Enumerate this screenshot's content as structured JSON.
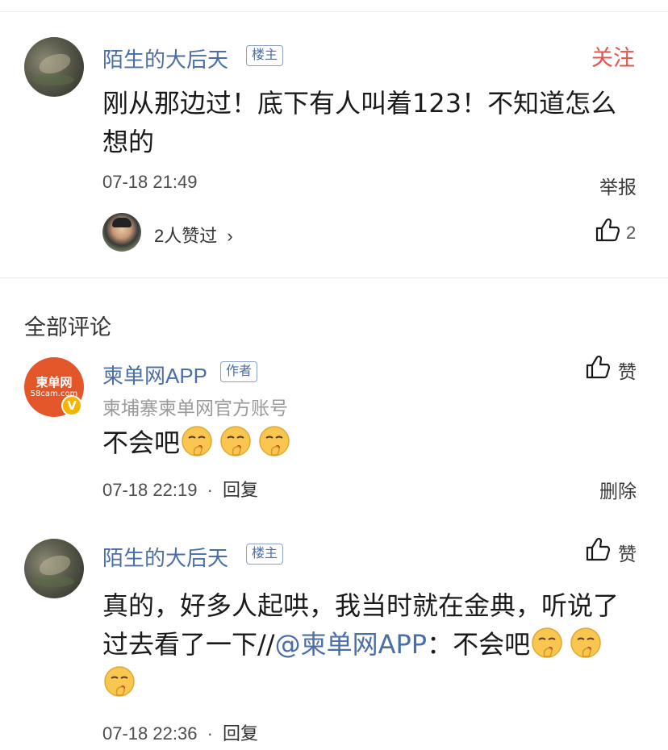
{
  "post": {
    "author": "陌生的大后天",
    "badge": "楼主",
    "follow_label": "关注",
    "content": "刚从那边过！底下有人叫着123！不知道怎么想的",
    "time": "07-18 21:49",
    "report_label": "举报",
    "likers_text": "2人赞过",
    "likers_chevron": "›",
    "like_count": "2"
  },
  "comments_section": {
    "title": "全部评论"
  },
  "comments": [
    {
      "author": "柬单网APP",
      "badge": "作者",
      "subtitle": "柬埔寨柬单网官方账号",
      "avatar_logo": "柬单网",
      "avatar_sub": "58cam.com",
      "verified_mark": "V",
      "content": "不会吧",
      "time": "07-18 22:19",
      "separator": "·",
      "reply_label": "回复",
      "like_label": "赞",
      "delete_label": "删除"
    },
    {
      "author": "陌生的大后天",
      "badge": "楼主",
      "content_a": "真的，好多人起哄，我当时就在金典，听说了过去看了一下//",
      "mention": "@柬单网APP",
      "content_b": "：不会吧",
      "time": "07-18 22:36",
      "separator": "·",
      "reply_label": "回复",
      "like_label": "赞"
    }
  ],
  "icons": [
    "thumbs-up-icon",
    "shushing-emoji-icon",
    "chevron-right-icon",
    "verified-icon"
  ],
  "colors": {
    "link_blue": "#4a6ea8",
    "follow_red": "#e0554f",
    "brand_orange": "#e2562a",
    "verified_yellow": "#f5b400"
  }
}
